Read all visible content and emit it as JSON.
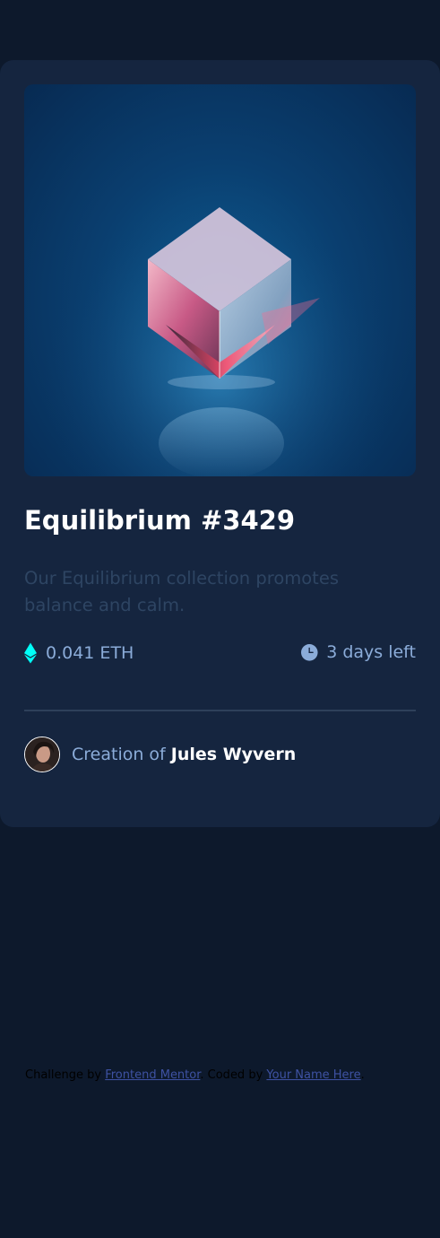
{
  "card": {
    "title": "Equilibrium #3429",
    "description": "Our Equilibrium collection promotes balance and calm.",
    "price": "0.041 ETH",
    "time_left": "3 days left",
    "creator_prefix": "Creation of",
    "creator_name": "Jules Wyvern",
    "price_icon": "ethereum-icon",
    "time_icon": "clock-icon"
  },
  "attribution": {
    "prefix": "Challenge by",
    "link1": "Frontend Mentor",
    "middle": ". Coded by",
    "link2": "Your Name Here",
    "suffix": "."
  },
  "colors": {
    "page_bg": "#0d192c",
    "card_bg": "#15253f",
    "cyan": "#00fff8",
    "soft_blue": "#8bacd9",
    "white": "#ffffff",
    "link": "#3e52a3"
  }
}
